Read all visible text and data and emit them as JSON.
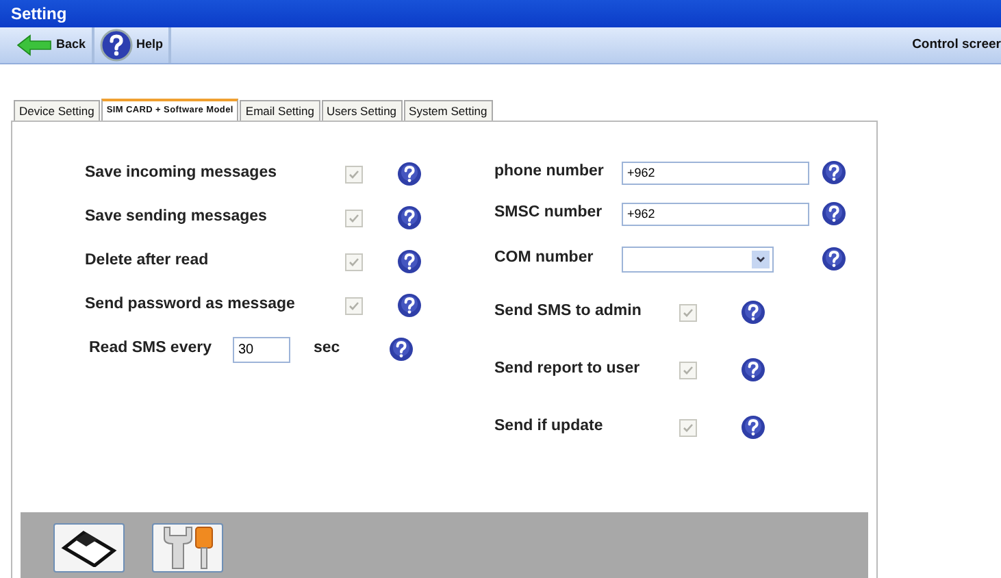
{
  "window": {
    "title": "Setting"
  },
  "toolbar": {
    "buttons": [
      {
        "label": "Back",
        "kind": "back"
      },
      {
        "label": "Help",
        "kind": "help"
      }
    ],
    "screen_title": "Control screer"
  },
  "tabs": [
    {
      "label": "Device Setting",
      "selected": false
    },
    {
      "label": "SIM CARD + Software Model",
      "selected": true
    },
    {
      "label": "Email Setting",
      "selected": false
    },
    {
      "label": "Users Setting",
      "selected": false
    },
    {
      "label": "System Setting",
      "selected": false
    }
  ],
  "left_settings": [
    {
      "kind": "checkbox",
      "label": "Save incoming messages",
      "checked": true
    },
    {
      "kind": "checkbox",
      "label": "Save sending messages",
      "checked": true
    },
    {
      "kind": "checkbox",
      "label": "Delete after read",
      "checked": true
    },
    {
      "kind": "checkbox",
      "label": "Send password as message",
      "checked": true
    },
    {
      "kind": "interval",
      "label": "Read SMS every",
      "value": "30",
      "unit": "sec"
    }
  ],
  "right_settings": [
    {
      "kind": "text",
      "label": "phone number",
      "value": "+962"
    },
    {
      "kind": "text",
      "label": "SMSC number",
      "value": "+962"
    },
    {
      "kind": "select",
      "label": "COM number"
    },
    {
      "kind": "checkbox",
      "label": "Send SMS to admin",
      "checked": true
    },
    {
      "kind": "checkbox",
      "label": "Send report to user",
      "checked": true
    },
    {
      "kind": "checkbox",
      "label": "Send if update",
      "checked": true
    }
  ],
  "bottom_bar": {
    "buttons": [
      {
        "kind": "save"
      },
      {
        "kind": "tools"
      }
    ]
  }
}
